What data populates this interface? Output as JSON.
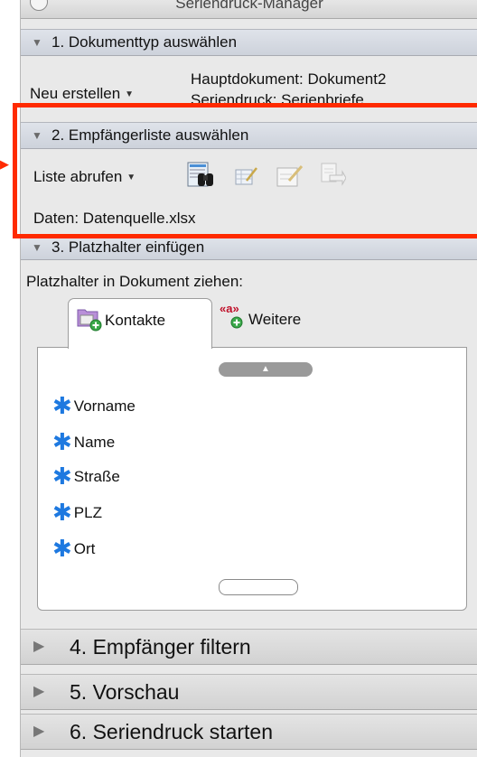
{
  "window": {
    "title": "Seriendruck-Manager"
  },
  "section1": {
    "header": "1. Dokumenttyp auswählen",
    "create_label": "Neu erstellen",
    "main_document": "Hauptdokument: Dokument2",
    "merge_type": "Seriendruck: Serienbriefe"
  },
  "section2": {
    "header": "2. Empfängerliste auswählen",
    "list_label": "Liste abrufen",
    "icons": [
      "find-recipient-icon",
      "edit-data-source-icon",
      "edit-recipient-icon",
      "filter-recipient-icon"
    ],
    "data_source": "Daten: Datenquelle.xlsx"
  },
  "section3": {
    "header": "3. Platzhalter einfügen",
    "instruction": "Platzhalter in Dokument ziehen:",
    "tabs": [
      {
        "label": "Kontakte",
        "icon": "contacts-add-icon",
        "selected": true
      },
      {
        "label": "Weitere",
        "icon": "field-add-icon",
        "badge": "«a»",
        "selected": false
      }
    ],
    "fields": [
      "Vorname",
      "Name",
      "Straße",
      "PLZ",
      "Ort"
    ]
  },
  "collapsed_sections": [
    "4. Empfänger filtern",
    "5. Vorschau",
    "6. Seriendruck starten"
  ],
  "colors": {
    "highlight": "#ff2a00",
    "field_star": "#1e79e0",
    "section_header": "#d6dae2"
  }
}
